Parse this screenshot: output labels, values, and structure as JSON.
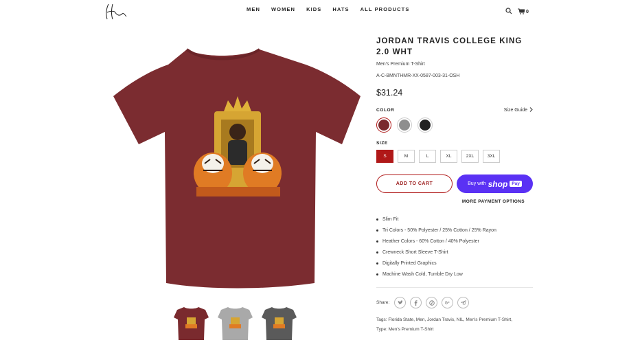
{
  "nav": {
    "items": [
      "MEN",
      "WOMEN",
      "KIDS",
      "HATS",
      "ALL PRODUCTS"
    ]
  },
  "header": {
    "logo_icon": "signature-logo",
    "search_icon": "search-icon",
    "cart_icon": "cart-icon",
    "cart_count": "0"
  },
  "product": {
    "title": "JORDAN TRAVIS COLLEGE KING 2.0 WHT",
    "subtitle": "Men's Premium T-Shirt",
    "sku": "A-C-BMNTHMR-XX-0587-003-31-OSH",
    "price": "$31.24",
    "color_label": "COLOR",
    "size_guide": "Size Guide",
    "colors": [
      {
        "name": "maroon",
        "hex": "#7a2a2e",
        "selected": true
      },
      {
        "name": "gray",
        "hex": "#8e8e8e",
        "selected": false
      },
      {
        "name": "black",
        "hex": "#222222",
        "selected": false
      }
    ],
    "size_label": "SIZE",
    "sizes": [
      "S",
      "M",
      "L",
      "XL",
      "2XL",
      "3XL"
    ],
    "selected_size": "S",
    "add_to_cart": "ADD TO CART",
    "shoppay": {
      "buy_with": "Buy with",
      "shop": "shop",
      "pay": "Pay"
    },
    "more_payment": "MORE PAYMENT OPTIONS",
    "features": [
      "Slim Fit",
      "Tri Colors - 50% Polyester / 25% Cotton / 25% Rayon",
      "Heather Colors - 60% Cotton / 40% Polyester",
      "Crewneck Short Sleeve T-Shirt",
      "Digitally Printed Graphics",
      "Machine Wash Cold, Tumble Dry Low"
    ],
    "share_label": "Share:",
    "social_icons": [
      "twitter-icon",
      "facebook-icon",
      "pinterest-icon",
      "google-plus-icon",
      "telegram-icon"
    ],
    "tags_line1": "Tags: Florida State, Men, Jordan Travis, NIL, Men's Premium T-Shirt,",
    "tags_line2": "Type: Men's Premium T-Shirt"
  },
  "thumbnails": [
    {
      "name": "maroon",
      "hex": "#7a2a2e"
    },
    {
      "name": "heather-gray",
      "hex": "#a9a9a9"
    },
    {
      "name": "charcoal",
      "hex": "#5a5a5a"
    }
  ],
  "colors": {
    "accent": "#b01818",
    "shirt_main": "#7b2c30",
    "shoppay": "#5a31f4"
  }
}
